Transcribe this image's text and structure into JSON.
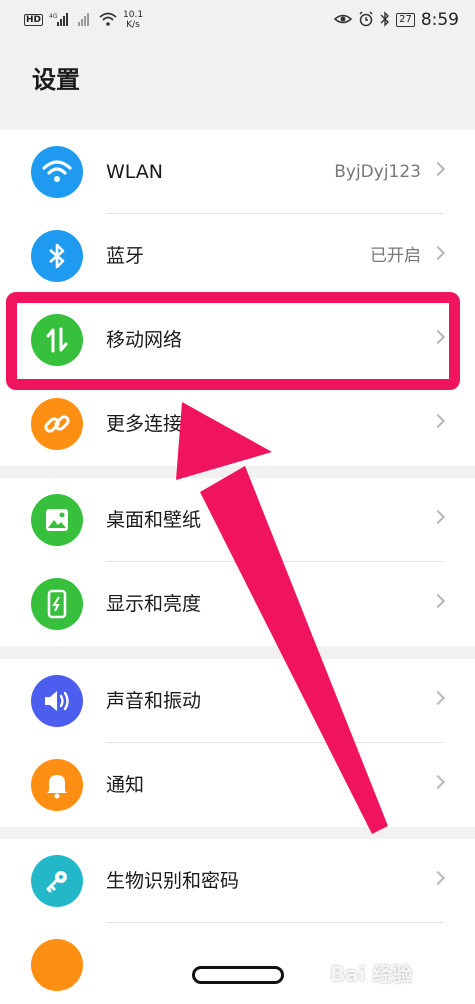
{
  "status_bar": {
    "hd": "HD",
    "net": "4G",
    "speed_value": "10.1",
    "speed_unit": "K/s",
    "battery": "27",
    "time": "8:59"
  },
  "page_title": "设置",
  "groups": [
    {
      "items": [
        {
          "label": "WLAN",
          "value": "ByjDyj123",
          "icon": "wifi-icon",
          "color": "#1e9bf0"
        },
        {
          "label": "蓝牙",
          "value": "已开启",
          "icon": "bluetooth-icon",
          "color": "#1e9bf0"
        },
        {
          "label": "移动网络",
          "value": "",
          "icon": "mobile-data-icon",
          "color": "#36c03c"
        },
        {
          "label": "更多连接",
          "value": "",
          "icon": "link-icon",
          "color": "#ff8f13"
        }
      ]
    },
    {
      "items": [
        {
          "label": "桌面和壁纸",
          "value": "",
          "icon": "wallpaper-icon",
          "color": "#36c03c"
        },
        {
          "label": "显示和亮度",
          "value": "",
          "icon": "display-icon",
          "color": "#36c03c"
        }
      ]
    },
    {
      "items": [
        {
          "label": "声音和振动",
          "value": "",
          "icon": "sound-icon",
          "color": "#4c5ef0"
        },
        {
          "label": "通知",
          "value": "",
          "icon": "bell-icon",
          "color": "#ff8f13"
        }
      ]
    },
    {
      "items": [
        {
          "label": "生物识别和密码",
          "value": "",
          "icon": "key-icon",
          "color": "#23b8c8"
        }
      ]
    }
  ],
  "annotation_color": "#f0135d",
  "watermark": "Bai 经验"
}
